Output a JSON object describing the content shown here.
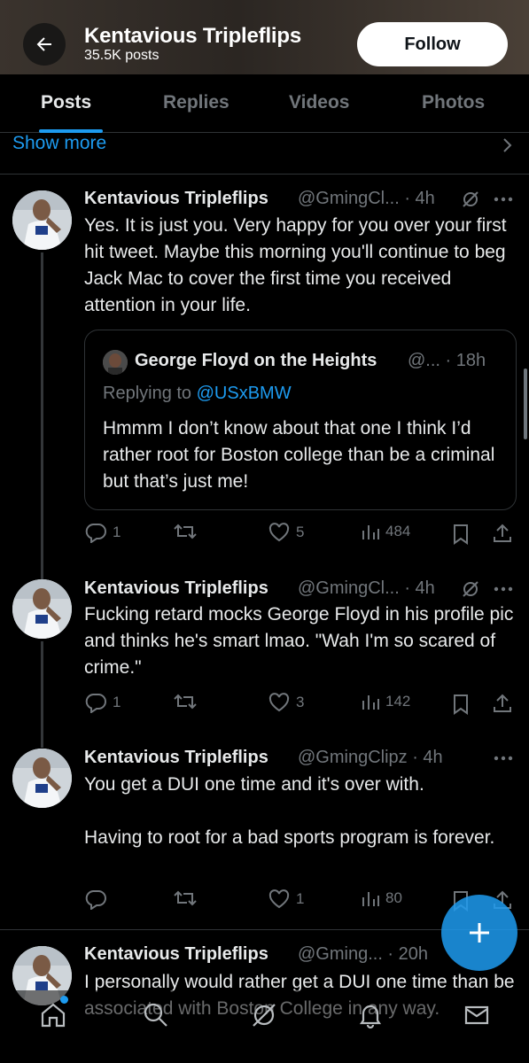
{
  "header": {
    "title": "Kentavious Tripleflips",
    "posts_count": "35.5K posts",
    "follow_label": "Follow"
  },
  "tabs": [
    {
      "label": "Posts",
      "active": true
    },
    {
      "label": "Replies",
      "active": false
    },
    {
      "label": "Videos",
      "active": false
    },
    {
      "label": "Photos",
      "active": false
    }
  ],
  "show_more": "Show more",
  "posts": [
    {
      "name": "Kentavious Tripleflips",
      "handle": "@GmingCl... · 4h",
      "text": "Yes. It is just you. Very happy for you over your first hit tweet. Maybe this morning you'll continue to beg Jack Mac to cover the first time you received attention in your life.",
      "quote": {
        "name": "George Floyd on the Heights",
        "handle": "@... · 18h",
        "replying_prefix": "Replying to ",
        "replying_to": "@USxBMW",
        "text": "Hmmm I don’t know about that one I think I’d rather root for Boston college than be a criminal but that’s just me!"
      },
      "replies": "1",
      "reposts": "",
      "likes": "5",
      "views": "484"
    },
    {
      "name": "Kentavious Tripleflips",
      "handle": "@GmingCl... · 4h",
      "text": "Fucking retard mocks George Floyd in his profile pic and thinks he's smart lmao. \"Wah I'm so scared of crime.\"",
      "replies": "1",
      "reposts": "",
      "likes": "3",
      "views": "142"
    },
    {
      "name": "Kentavious Tripleflips",
      "handle": "@GmingClipz · 4h",
      "text": "You get a DUI one time and it's over with.\n\nHaving to root for a bad sports program is forever.",
      "replies": "",
      "reposts": "",
      "likes": "1",
      "views": "80"
    },
    {
      "name": "Kentavious Tripleflips",
      "handle": "@Gming... · 20h",
      "text": "I personally would rather get a DUI one time than be associated with Boston College in any way."
    }
  ],
  "colors": {
    "accent": "#1d9bf0",
    "muted": "#71767b",
    "text": "#e7e9ea",
    "border": "#2f3336",
    "background": "#000000"
  },
  "icons": [
    "back-arrow-icon",
    "chevron-right-icon",
    "grok-icon",
    "more-icon",
    "reply-icon",
    "repost-icon",
    "like-icon",
    "views-icon",
    "bookmark-icon",
    "share-icon",
    "compose-icon",
    "home-icon",
    "search-icon",
    "grok-nav-icon",
    "notifications-icon",
    "messages-icon"
  ]
}
